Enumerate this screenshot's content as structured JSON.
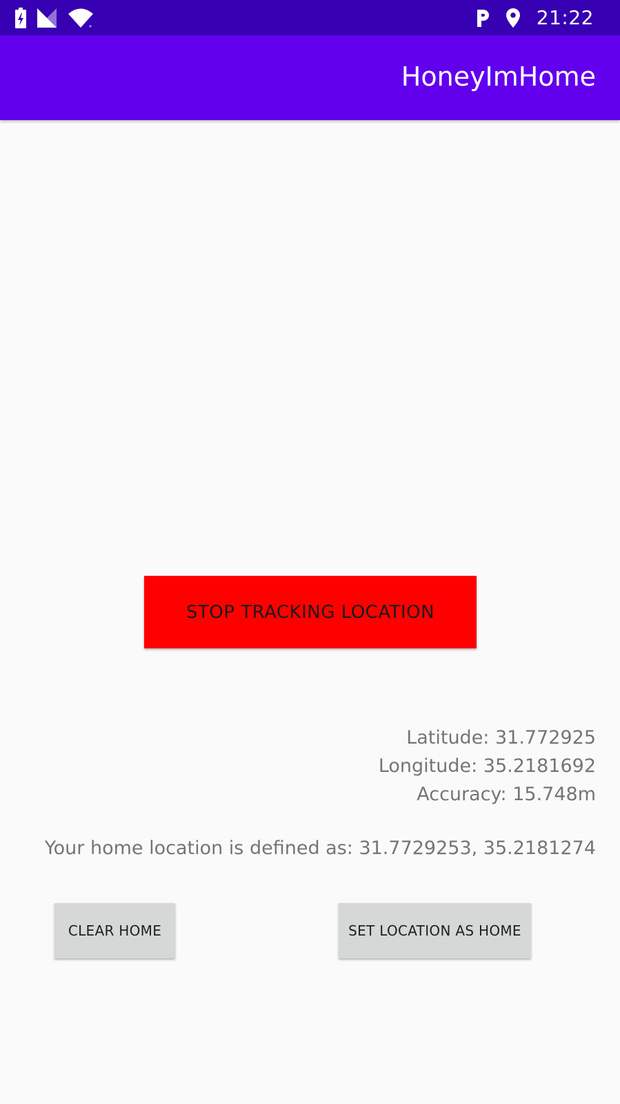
{
  "status_bar": {
    "time": "21:22",
    "icons": [
      "battery-charging-icon",
      "cell-signal-icon",
      "wifi-icon",
      "parking-icon",
      "location-pin-icon"
    ],
    "background_color": "#3700b3"
  },
  "app_bar": {
    "title": "HoneyImHome",
    "background_color": "#6200ee"
  },
  "tracking": {
    "button_label": "STOP TRACKING LOCATION",
    "button_color": "#ff0000"
  },
  "location": {
    "latitude": "Latitude: 31.772925",
    "longitude": "Longitude: 35.2181692",
    "accuracy": "Accuracy: 15.748m"
  },
  "home": {
    "defined_text": "Your home location is defined as: 31.7729253, 35.2181274"
  },
  "actions": {
    "clear_home_label": "CLEAR HOME",
    "set_home_label": "SET LOCATION AS HOME"
  }
}
